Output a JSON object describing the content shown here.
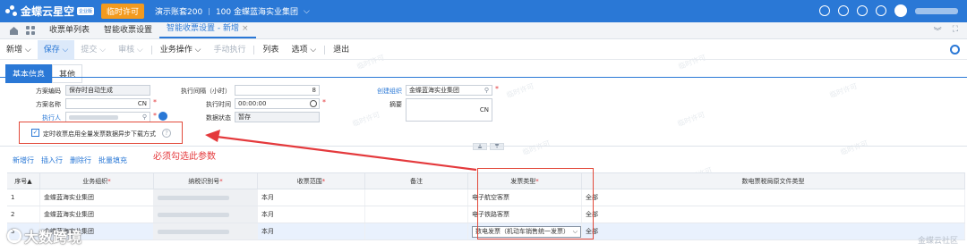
{
  "topbar": {
    "brand": "金蝶云星空",
    "brand_badge": "企业版",
    "temp_license": "临时许可",
    "account": "演示账套200",
    "org": "100 金蝶蓝海实业集团",
    "org_chevron": "⌵"
  },
  "tabs": [
    {
      "label": "收票单列表"
    },
    {
      "label": "智能收票设置"
    },
    {
      "label": "智能收票设置 - 新增",
      "close": "×"
    }
  ],
  "toolbar": {
    "new": "新增 ⌵",
    "save": "保存 ⌵",
    "submit": "提交 ⌵",
    "audit": "审核 ⌵",
    "business_ops": "业务操作 ⌵",
    "manual_exec": "手动执行",
    "list": "列表",
    "options": "选项 ⌵",
    "exit": "退出"
  },
  "subtabs": {
    "basic": "基本信息",
    "other": "其他"
  },
  "form": {
    "scheme_code_label": "方案编码",
    "scheme_code_value": "保存时自动生成",
    "scheme_name_label": "方案名称",
    "scheme_name_lang": "CN",
    "executor_label": "执行人",
    "interval_label": "执行间隔（小时）",
    "interval_value": "8",
    "exec_time_label": "执行时间",
    "exec_time_value": "00:00:00",
    "data_status_label": "数据状态",
    "data_status_value": "暂存",
    "create_org_label": "创建组织",
    "create_org_value": "金蝶蓝海实业集团",
    "summary_label": "摘要",
    "summary_lang": "CN",
    "async_checkbox_label": "定时收票启用全量发票数据异步下载方式",
    "checkbox_mark": "✓"
  },
  "annotation": "必须勾选此参数",
  "entry_toolbar": [
    "新增行",
    "插入行",
    "删除行",
    "批量填充"
  ],
  "table": {
    "headers": {
      "seq": "序号▲",
      "org": "业务组织",
      "tax": "纳税识别号",
      "range": "收票范围",
      "note": "备注",
      "inv": "发票类型",
      "file": "数电票税局原文件类型"
    },
    "rows": [
      {
        "seq": "1",
        "org": "金蝶蓝海实业集团",
        "range": "本月",
        "note": "",
        "inv": "电子航空客票",
        "file": "全部"
      },
      {
        "seq": "2",
        "org": "金蝶蓝海实业集团",
        "range": "本月",
        "note": "",
        "inv": "电子铁路客票",
        "file": "全部"
      },
      {
        "seq": "3",
        "org": "金蝶蓝海实业集团",
        "range": "本月",
        "note": "",
        "inv": "数电发票（机动车销售统一发票）",
        "file": "全部"
      }
    ]
  },
  "watermark": "临时许可",
  "footer": {
    "brand": "大数跨境",
    "community": "金蝶云社区"
  },
  "colors": {
    "primary": "#2a78d6",
    "license": "#f39a1e",
    "annotation_red": "#e4393c"
  }
}
